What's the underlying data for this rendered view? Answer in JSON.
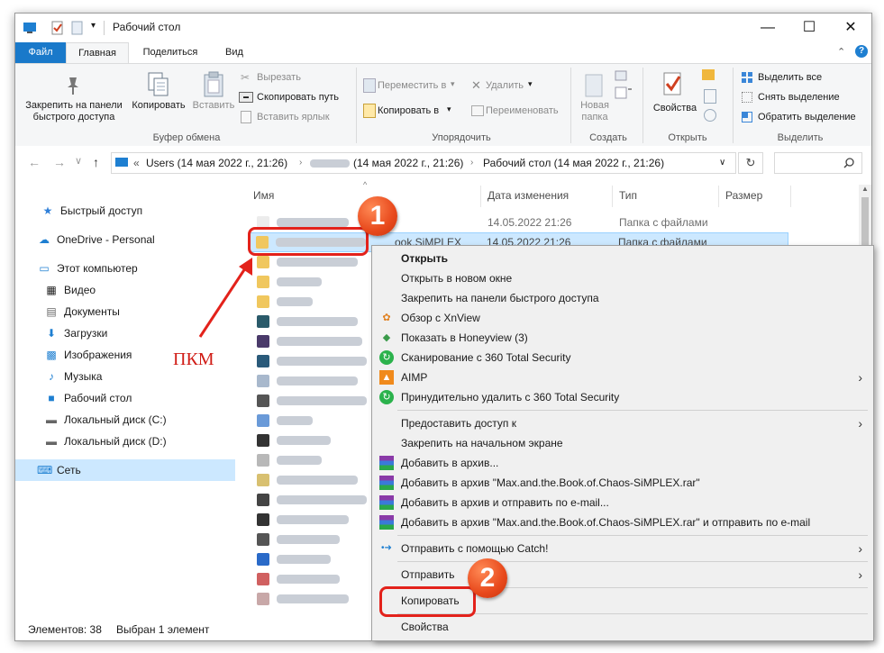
{
  "window": {
    "title": "Рабочий стол",
    "controls": {
      "minimize": "—",
      "maximize": "☐",
      "close": "✕"
    }
  },
  "tabs": [
    {
      "label": "Файл",
      "active": false
    },
    {
      "label": "Главная",
      "active": true
    },
    {
      "label": "Поделиться",
      "active": false
    },
    {
      "label": "Вид",
      "active": false
    }
  ],
  "ribbon": {
    "clipboard": {
      "pin": "Закрепить на панели быстрого доступа",
      "pin_line1": "Закрепить на панели",
      "pin_line2": "быстрого доступа",
      "copy": "Копировать",
      "paste": "Вставить",
      "cut": "Вырезать",
      "copy_path": "Скопировать путь",
      "paste_shortcut": "Вставить ярлык",
      "label": "Буфер обмена"
    },
    "organize": {
      "move_to": "Переместить в",
      "copy_to": "Копировать в",
      "delete": "Удалить",
      "rename": "Переименовать",
      "label": "Упорядочить"
    },
    "create": {
      "new_folder_line1": "Новая",
      "new_folder_line2": "папка",
      "label": "Создать"
    },
    "open": {
      "properties": "Свойства",
      "label": "Открыть"
    },
    "select": {
      "select_all": "Выделить все",
      "select_none": "Снять выделение",
      "invert": "Обратить выделение",
      "label": "Выделить"
    }
  },
  "address": {
    "seg1": "Users (14 мая 2022 г., 21:26)",
    "seg2": "(14 мая 2022 г., 21:26)",
    "seg3": "Рабочий стол (14 мая 2022 г., 21:26)"
  },
  "nav": [
    {
      "label": "Быстрый доступ",
      "icon": "star-icon"
    },
    {
      "label": "OneDrive - Personal",
      "icon": "cloud-icon"
    },
    {
      "label": "Этот компьютер",
      "icon": "computer-icon"
    },
    {
      "label": "Видео",
      "icon": "video-icon"
    },
    {
      "label": "Документы",
      "icon": "document-icon"
    },
    {
      "label": "Загрузки",
      "icon": "download-icon"
    },
    {
      "label": "Изображения",
      "icon": "pictures-icon"
    },
    {
      "label": "Музыка",
      "icon": "music-icon"
    },
    {
      "label": "Рабочий стол",
      "icon": "desktop-icon"
    },
    {
      "label": "Локальный диск (C:)",
      "icon": "drive-icon"
    },
    {
      "label": "Локальный диск (D:)",
      "icon": "drive-icon"
    },
    {
      "label": "Сеть",
      "icon": "network-icon"
    }
  ],
  "columns": {
    "name": "Имя",
    "date": "Дата изменения",
    "type": "Тип",
    "size": "Размер"
  },
  "rows": [
    {
      "date": "14.05.2022 21:26",
      "type": "Папка с файлами"
    },
    {
      "date": "14.05.2022 21:26",
      "type": "Папка с файлами",
      "name_suffix": "ook.SiMPLEX"
    }
  ],
  "status": {
    "count": "Элементов: 38",
    "selected": "Выбран 1 элемент"
  },
  "context_menu": [
    {
      "label": "Открыть",
      "bold": true
    },
    {
      "label": "Открыть в новом окне"
    },
    {
      "label": "Закрепить на панели быстрого доступа"
    },
    {
      "label": "Обзор с XnView",
      "icon": "xnview-icon"
    },
    {
      "label": "Показать в Honeyview (3)",
      "icon": "honeyview-icon"
    },
    {
      "label": "Сканирование с 360 Total Security",
      "icon": "360-security-icon"
    },
    {
      "label": "AIMP",
      "icon": "aimp-icon",
      "submenu": true
    },
    {
      "label": "Принудительно удалить с  360 Total Security",
      "icon": "360-security-icon"
    },
    {
      "label": "Предоставить доступ к",
      "submenu": true
    },
    {
      "label": "Закрепить на начальном экране"
    },
    {
      "label": "Добавить в архив...",
      "icon": "winrar-icon"
    },
    {
      "label": "Добавить в архив \"Max.and.the.Book.of.Chaos-SiMPLEX.rar\"",
      "icon": "winrar-icon"
    },
    {
      "label": "Добавить в архив и отправить по e-mail...",
      "icon": "winrar-icon"
    },
    {
      "label": "Добавить в архив \"Max.and.the.Book.of.Chaos-SiMPLEX.rar\" и отправить по e-mail",
      "icon": "winrar-icon"
    },
    {
      "label": "Отправить с помощью Catch!",
      "icon": "catch-icon",
      "submenu": true
    },
    {
      "label": "Отправить",
      "submenu": true
    },
    {
      "label": "Копировать"
    },
    {
      "label": "Свойства"
    }
  ],
  "annotations": {
    "step1": "1",
    "step2": "2",
    "pkm": "ПКМ"
  }
}
